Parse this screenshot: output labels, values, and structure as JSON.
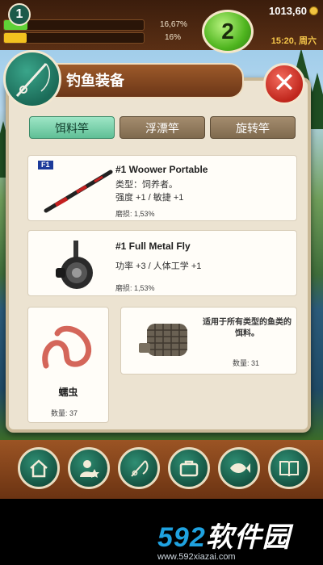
{
  "hud": {
    "bar1_text": "16,67%",
    "bar1_fraction": 0.1667,
    "bar2_text": "16%",
    "bar2_fraction": 0.16,
    "level": "2",
    "money": "1013,60",
    "time": "15:20, 周六"
  },
  "header": {
    "badge_number": "1",
    "title": "钓鱼装备",
    "close_label": "✕"
  },
  "tabs": [
    "饵料竿",
    "浮漂竿",
    "旋转竿"
  ],
  "rod": {
    "tag": "F1",
    "name": "#1 Woower Portable",
    "line1": "类型：饲养者。",
    "line2": "强度 +1 / 敏捷 +1",
    "wear": "磨损: 1,53%"
  },
  "reel": {
    "name": "#1 Full Metal Fly",
    "line1": "功率 +3 / 人体工学 +1",
    "wear": "磨损: 1,53%"
  },
  "bait": {
    "name": "蠕虫",
    "count": "数量: 37"
  },
  "feeder": {
    "desc": "适用于所有类型的鱼类的饵料。",
    "count": "数量: 31"
  },
  "bottom_nav": [
    "home-icon",
    "profile-icon",
    "fishing-rod-icon",
    "briefcase-icon",
    "fish-icon",
    "book-icon"
  ],
  "watermark": {
    "logo_a": "592",
    "logo_b": "软件园",
    "url": "www.592xiazai.com"
  }
}
